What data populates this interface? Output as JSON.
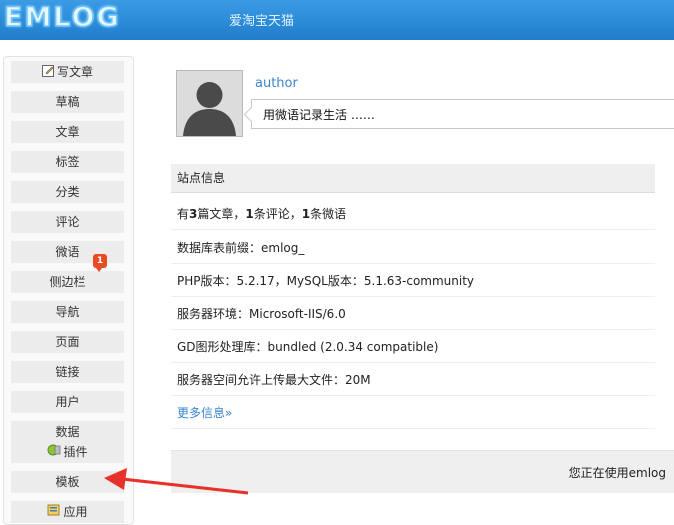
{
  "header": {
    "logo": "EMLOG",
    "site_name": "爱淘宝天猫"
  },
  "sidebar": {
    "items": [
      {
        "label": "写文章",
        "icon": "pencil-icon"
      },
      {
        "label": "草稿"
      },
      {
        "label": "文章"
      },
      {
        "label": "标签"
      },
      {
        "label": "分类"
      },
      {
        "label": "评论",
        "badge": "1"
      },
      {
        "label": "微语"
      },
      {
        "label": "侧边栏"
      },
      {
        "label": "导航"
      },
      {
        "label": "页面"
      },
      {
        "label": "链接"
      },
      {
        "label": "用户"
      },
      {
        "label": "数据"
      },
      {
        "label": "插件",
        "icon": "plugin-icon"
      },
      {
        "label": "模板"
      },
      {
        "label": "应用",
        "icon": "app-icon"
      }
    ]
  },
  "profile": {
    "author": "author",
    "twitter_placeholder": "用微语记录生活 ……"
  },
  "siteinfo": {
    "title": "站点信息",
    "stats": {
      "p1": "有",
      "articles": "3",
      "p2": "篇文章，",
      "comments": "1",
      "p3": "条评论，",
      "twitters": "1",
      "p4": "条微语"
    },
    "rows": [
      "数据库表前缀：emlog_",
      "PHP版本：5.2.17，MySQL版本：5.1.63-community",
      "服务器环境：Microsoft-IIS/6.0",
      "GD图形处理库：bundled (2.0.34 compatible)",
      "服务器空间允许上传最大文件：20M"
    ],
    "more": "更多信息»"
  },
  "footer": {
    "text": "您正在使用emlog"
  },
  "colors": {
    "header": "#2b8cdb",
    "link": "#3a85d0",
    "badge": "#e84a24",
    "arrow": "#e8312a"
  }
}
